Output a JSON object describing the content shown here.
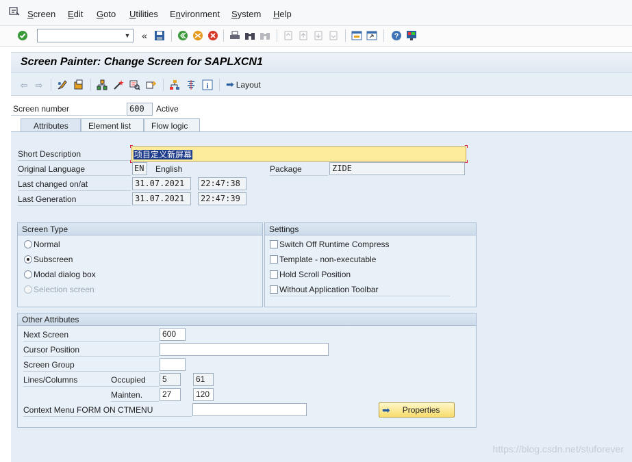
{
  "menu": [
    "Screen",
    "Edit",
    "Goto",
    "Utilities",
    "Environment",
    "System",
    "Help"
  ],
  "menu_underline": [
    "S",
    "E",
    "G",
    "U",
    "n",
    "S",
    "H"
  ],
  "title": "Screen Painter: Change Screen for SAPLXCN1",
  "app_toolbar": {
    "layout_label": "Layout"
  },
  "header": {
    "screen_number_label": "Screen number",
    "screen_number": "600",
    "status": "Active"
  },
  "tabs": [
    "Attributes",
    "Element list",
    "Flow logic"
  ],
  "attributes": {
    "short_desc_label": "Short Description",
    "short_desc": "项目定义新屏幕",
    "orig_lang_label": "Original Language",
    "orig_lang_code": "EN",
    "orig_lang_name": "English",
    "package_label": "Package",
    "package": "ZIDE",
    "last_changed_label": "Last changed on/at",
    "last_changed_date": "31.07.2021",
    "last_changed_time": "22:47:38",
    "last_gen_label": "Last Generation",
    "last_gen_date": "31.07.2021",
    "last_gen_time": "22:47:39"
  },
  "screen_type": {
    "title": "Screen Type",
    "options": [
      "Normal",
      "Subscreen",
      "Modal dialog box",
      "Selection screen"
    ],
    "selected": "Subscreen"
  },
  "settings": {
    "title": "Settings",
    "options": [
      "Switch Off Runtime Compress",
      "Template - non-executable",
      "Hold Scroll Position",
      "Without Application Toolbar"
    ]
  },
  "other": {
    "title": "Other Attributes",
    "next_screen_label": "Next Screen",
    "next_screen": "600",
    "cursor_pos_label": "Cursor Position",
    "cursor_pos": "",
    "screen_group_label": "Screen Group",
    "screen_group": "",
    "lines_cols_label": "Lines/Columns",
    "occupied_label": "Occupied",
    "occupied_lines": "5",
    "occupied_cols": "61",
    "mainten_label": "Mainten.",
    "mainten_lines": "27",
    "mainten_cols": "120",
    "context_menu_label": "Context Menu FORM ON CTMENU",
    "context_menu": "",
    "properties_label": "Properties"
  },
  "watermark": "https://blog.csdn.net/stuforever",
  "colors": {
    "title_bg": "#dfe8f1",
    "panel_bg": "#e5eef7",
    "input_highlight": "#fbeb9a",
    "button_yellow": "#f7dc6c"
  }
}
